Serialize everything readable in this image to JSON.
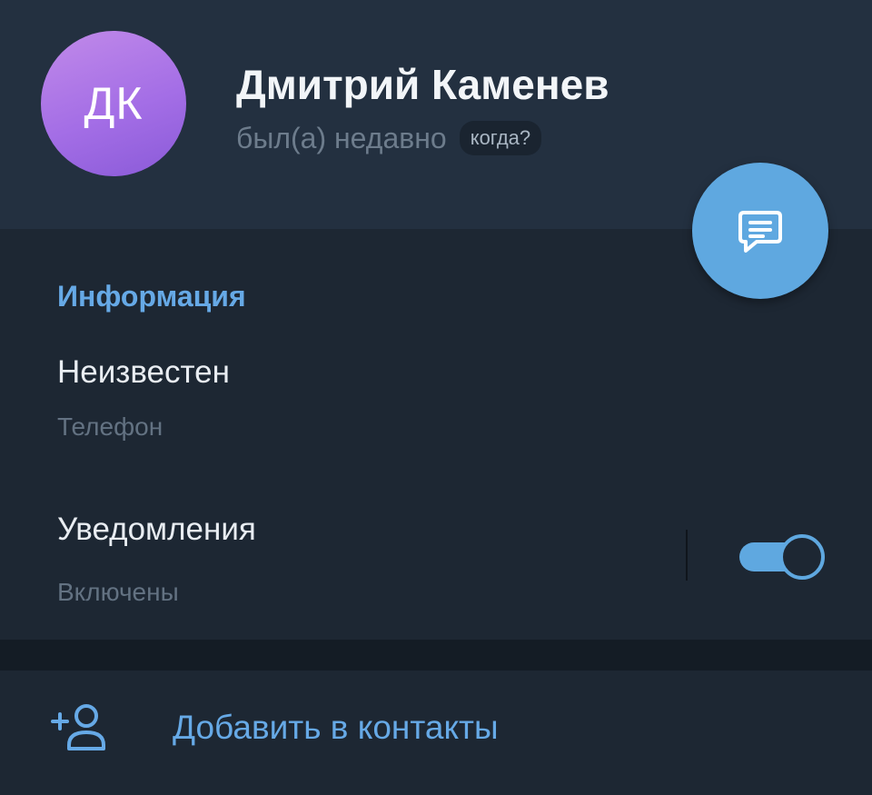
{
  "profile": {
    "avatar_initials": "ДК",
    "name": "Дмитрий Каменев",
    "status": "был(а) недавно",
    "when_label": "когда?"
  },
  "fab": {
    "icon": "message-icon"
  },
  "info": {
    "section_title": "Информация",
    "phone_value": "Неизвестен",
    "phone_label": "Телефон",
    "notifications_title": "Уведомления",
    "notifications_state": "Включены",
    "notifications_enabled": true
  },
  "actions": {
    "add_contact_icon": "add-contact-icon",
    "add_contact_label": "Добавить в контакты"
  },
  "colors": {
    "accent": "#5fa8e0",
    "background": "#1d2733",
    "header": "#233040",
    "avatar": "#a46ee6"
  }
}
